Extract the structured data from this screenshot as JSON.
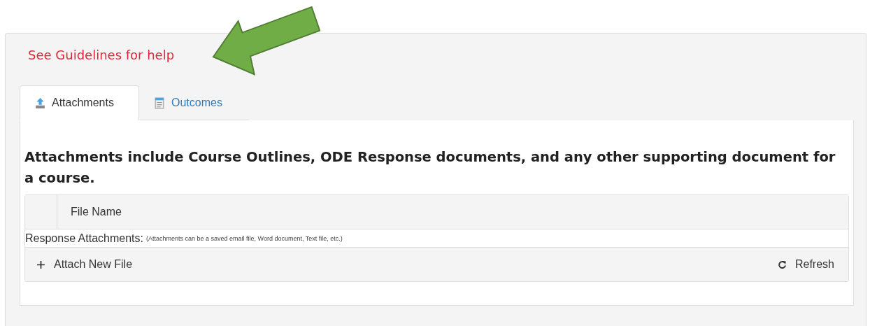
{
  "help_link": "See Guidelines for help",
  "tabs": [
    {
      "label": "Attachments",
      "kind": "upload",
      "selected": true
    },
    {
      "label": "Outcomes",
      "kind": "sheet",
      "selected": false
    }
  ],
  "heading": "Attachments include Course Outlines, ODE Response documents, and any other supporting document for a course.",
  "table": {
    "columns": [
      "File Name"
    ],
    "group_label": "Response Attachments:",
    "group_note": "(Attachments can be a saved email file, Word document, Text file, etc.)"
  },
  "toolbar": {
    "attach": "Attach New File",
    "refresh": "Refresh"
  }
}
